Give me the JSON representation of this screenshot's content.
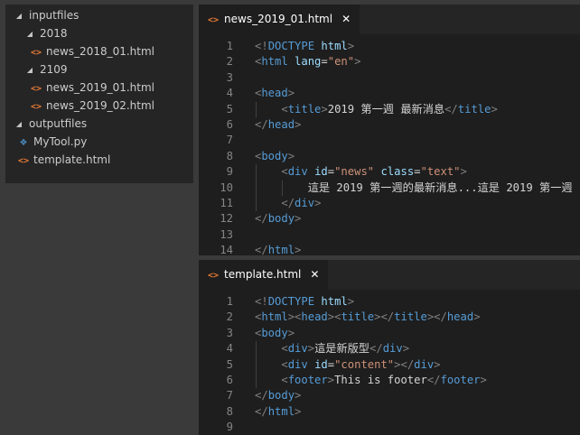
{
  "explorer": {
    "items": [
      {
        "label": "inputfiles",
        "type": "folder",
        "expanded": true
      },
      {
        "label": "2018",
        "type": "folder",
        "expanded": true
      },
      {
        "label": "news_2018_01.html",
        "type": "html"
      },
      {
        "label": "2109",
        "type": "folder",
        "expanded": true
      },
      {
        "label": "news_2019_01.html",
        "type": "html"
      },
      {
        "label": "news_2019_02.html",
        "type": "html"
      },
      {
        "label": "outputfiles",
        "type": "folder",
        "expanded": true
      },
      {
        "label": "MyTool.py",
        "type": "py"
      },
      {
        "label": "template.html",
        "type": "html"
      }
    ]
  },
  "editor_top": {
    "tab_label": "news_2019_01.html",
    "line_numbers": [
      "1",
      "2",
      "3",
      "4",
      "5",
      "6",
      "7",
      "8",
      "9",
      "10",
      "11",
      "12",
      "13",
      "14"
    ],
    "lines": [
      [
        [
          "p",
          "<!"
        ],
        [
          "t",
          "DOCTYPE"
        ],
        [
          "x",
          " "
        ],
        [
          "a",
          "html"
        ],
        [
          "p",
          ">"
        ]
      ],
      [
        [
          "p",
          "<"
        ],
        [
          "t",
          "html"
        ],
        [
          "x",
          " "
        ],
        [
          "a",
          "lang"
        ],
        [
          "x",
          "="
        ],
        [
          "s",
          "\"en\""
        ],
        [
          "p",
          ">"
        ]
      ],
      [],
      [
        [
          "p",
          "<"
        ],
        [
          "t",
          "head"
        ],
        [
          "p",
          ">"
        ]
      ],
      [
        [
          "x",
          "    "
        ],
        [
          "p",
          "<"
        ],
        [
          "t",
          "title"
        ],
        [
          "p",
          ">"
        ],
        [
          "x",
          "2019 第一週 最新消息"
        ],
        [
          "p",
          "</"
        ],
        [
          "t",
          "title"
        ],
        [
          "p",
          ">"
        ]
      ],
      [
        [
          "p",
          "</"
        ],
        [
          "t",
          "head"
        ],
        [
          "p",
          ">"
        ]
      ],
      [],
      [
        [
          "p",
          "<"
        ],
        [
          "t",
          "body"
        ],
        [
          "p",
          ">"
        ]
      ],
      [
        [
          "x",
          "    "
        ],
        [
          "p",
          "<"
        ],
        [
          "t",
          "div"
        ],
        [
          "x",
          " "
        ],
        [
          "a",
          "id"
        ],
        [
          "x",
          "="
        ],
        [
          "s",
          "\"news\""
        ],
        [
          "x",
          " "
        ],
        [
          "a",
          "class"
        ],
        [
          "x",
          "="
        ],
        [
          "s",
          "\"text\""
        ],
        [
          "p",
          ">"
        ]
      ],
      [
        [
          "x",
          "        這是 2019 第一週的最新消息...這是 2019 第一週"
        ]
      ],
      [
        [
          "x",
          "    "
        ],
        [
          "p",
          "</"
        ],
        [
          "t",
          "div"
        ],
        [
          "p",
          ">"
        ]
      ],
      [
        [
          "p",
          "</"
        ],
        [
          "t",
          "body"
        ],
        [
          "p",
          ">"
        ]
      ],
      [],
      [
        [
          "p",
          "</"
        ],
        [
          "t",
          "html"
        ],
        [
          "p",
          ">"
        ]
      ]
    ]
  },
  "editor_bottom": {
    "tab_label": "template.html",
    "line_numbers": [
      "1",
      "2",
      "3",
      "4",
      "5",
      "6",
      "7",
      "8",
      "9"
    ],
    "lines": [
      [
        [
          "p",
          "<!"
        ],
        [
          "t",
          "DOCTYPE"
        ],
        [
          "x",
          " "
        ],
        [
          "a",
          "html"
        ],
        [
          "p",
          ">"
        ]
      ],
      [
        [
          "p",
          "<"
        ],
        [
          "t",
          "html"
        ],
        [
          "p",
          "><"
        ],
        [
          "t",
          "head"
        ],
        [
          "p",
          "><"
        ],
        [
          "t",
          "title"
        ],
        [
          "p",
          "></"
        ],
        [
          "t",
          "title"
        ],
        [
          "p",
          "></"
        ],
        [
          "t",
          "head"
        ],
        [
          "p",
          ">"
        ]
      ],
      [
        [
          "p",
          "<"
        ],
        [
          "t",
          "body"
        ],
        [
          "p",
          ">"
        ]
      ],
      [
        [
          "x",
          "    "
        ],
        [
          "p",
          "<"
        ],
        [
          "t",
          "div"
        ],
        [
          "p",
          ">"
        ],
        [
          "x",
          "這是新版型"
        ],
        [
          "p",
          "</"
        ],
        [
          "t",
          "div"
        ],
        [
          "p",
          ">"
        ]
      ],
      [
        [
          "x",
          "    "
        ],
        [
          "p",
          "<"
        ],
        [
          "t",
          "div"
        ],
        [
          "x",
          " "
        ],
        [
          "a",
          "id"
        ],
        [
          "x",
          "="
        ],
        [
          "s",
          "\"content\""
        ],
        [
          "p",
          "></"
        ],
        [
          "t",
          "div"
        ],
        [
          "p",
          ">"
        ]
      ],
      [
        [
          "x",
          "    "
        ],
        [
          "p",
          "<"
        ],
        [
          "t",
          "footer"
        ],
        [
          "p",
          ">"
        ],
        [
          "x",
          "This is footer"
        ],
        [
          "p",
          "</"
        ],
        [
          "t",
          "footer"
        ],
        [
          "p",
          ">"
        ]
      ],
      [
        [
          "p",
          "</"
        ],
        [
          "t",
          "body"
        ],
        [
          "p",
          ">"
        ]
      ],
      [
        [
          "p",
          "</"
        ],
        [
          "t",
          "html"
        ],
        [
          "p",
          ">"
        ]
      ],
      []
    ]
  },
  "colors": {
    "background": "#1e1e1e",
    "sidebar": "#252526",
    "tag": "#569cd6",
    "attribute": "#9cdcfe",
    "string": "#ce9178",
    "punctuation": "#808080",
    "text": "#d4d4d4",
    "line_number": "#858585",
    "html_icon": "#e37933",
    "python_icon": "#4b8bbe"
  },
  "icons": {
    "folder_expanded": "chevron-down-icon",
    "html_file": "html-file-icon",
    "python_file": "python-file-icon",
    "close": "close-icon"
  }
}
